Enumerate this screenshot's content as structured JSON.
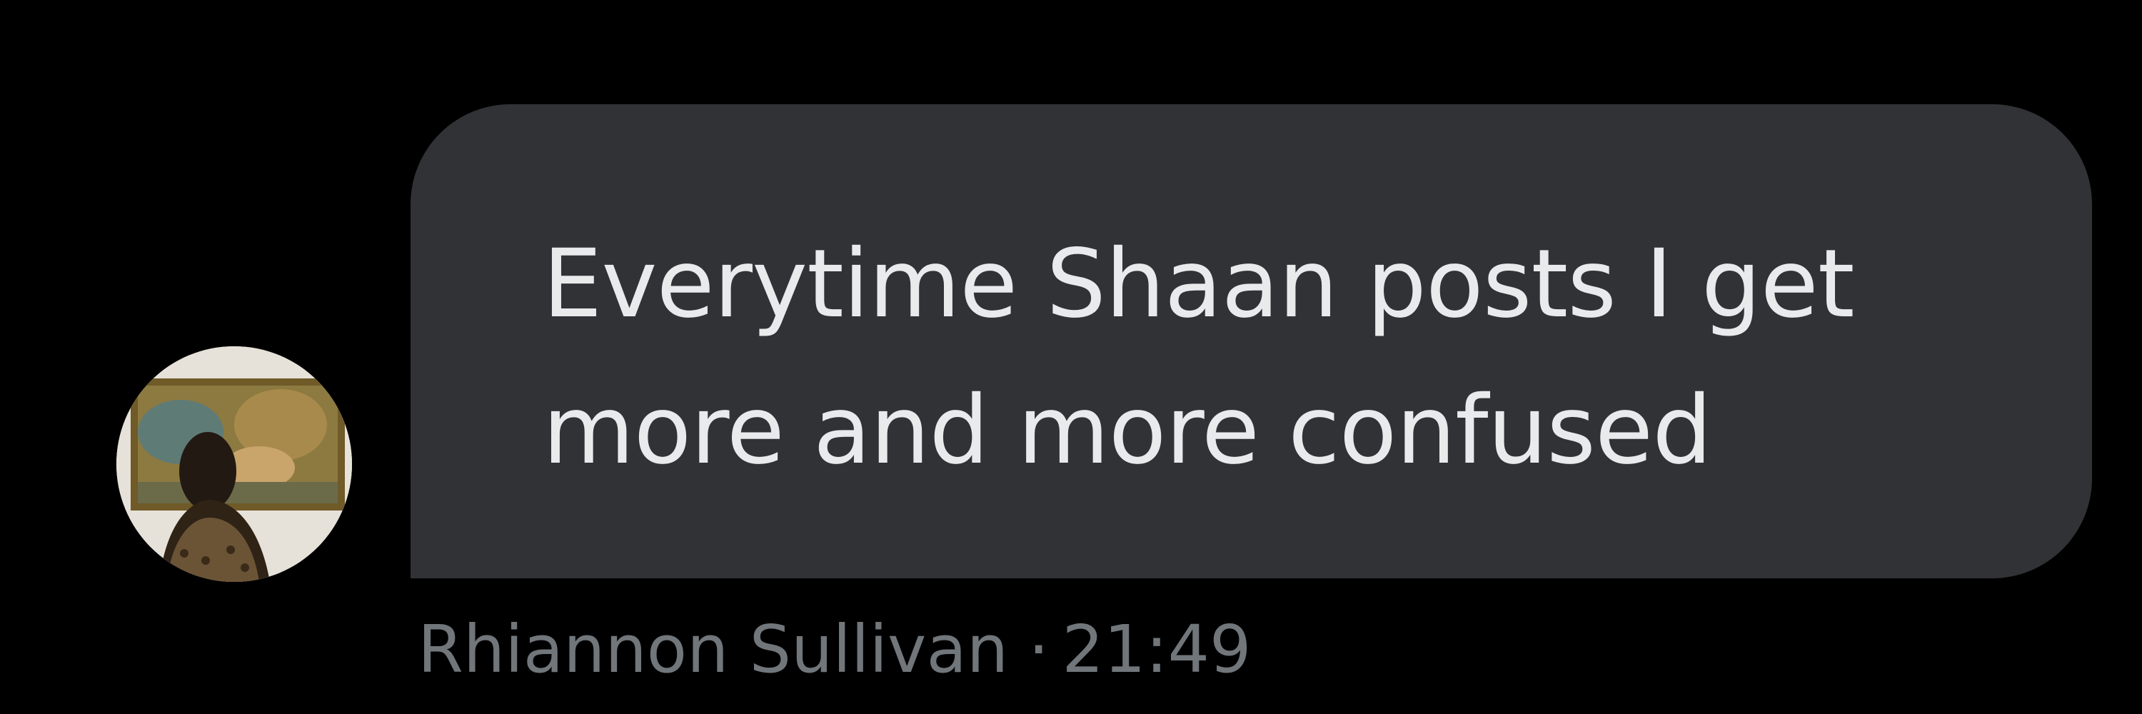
{
  "conversation": {
    "message": {
      "text": "Everytime Shaan posts I get more and more confused",
      "sender": "Rhiannon Sullivan",
      "separator": "·",
      "time": "21:49"
    },
    "avatar": {
      "icon": "profile-photo-avatar",
      "description_colors": {
        "frame": "#e9e4dc",
        "painting": "#8a7a3c",
        "hair": "#2a1d15"
      }
    }
  },
  "colors": {
    "background": "#000000",
    "bubble": "#303235",
    "message_text": "#e9eaeb",
    "meta_text": "#71767b"
  }
}
